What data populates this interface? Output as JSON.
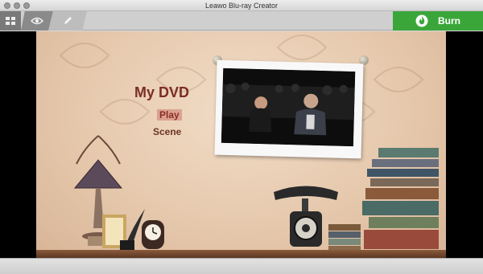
{
  "window": {
    "title": "Leawo Blu-ray Creator"
  },
  "toolbar": {
    "items": [
      {
        "icon": "grid-icon"
      },
      {
        "icon": "eye-icon"
      },
      {
        "icon": "pencil-icon"
      }
    ],
    "burn": {
      "label": "Burn",
      "icon": "flame-icon"
    }
  },
  "menu": {
    "title": "My DVD",
    "items": [
      "Play",
      "Scene"
    ]
  },
  "colors": {
    "burn_green": "#3aa63a",
    "title_red": "#7a2e23",
    "background_peach": "#e6c9ad"
  }
}
